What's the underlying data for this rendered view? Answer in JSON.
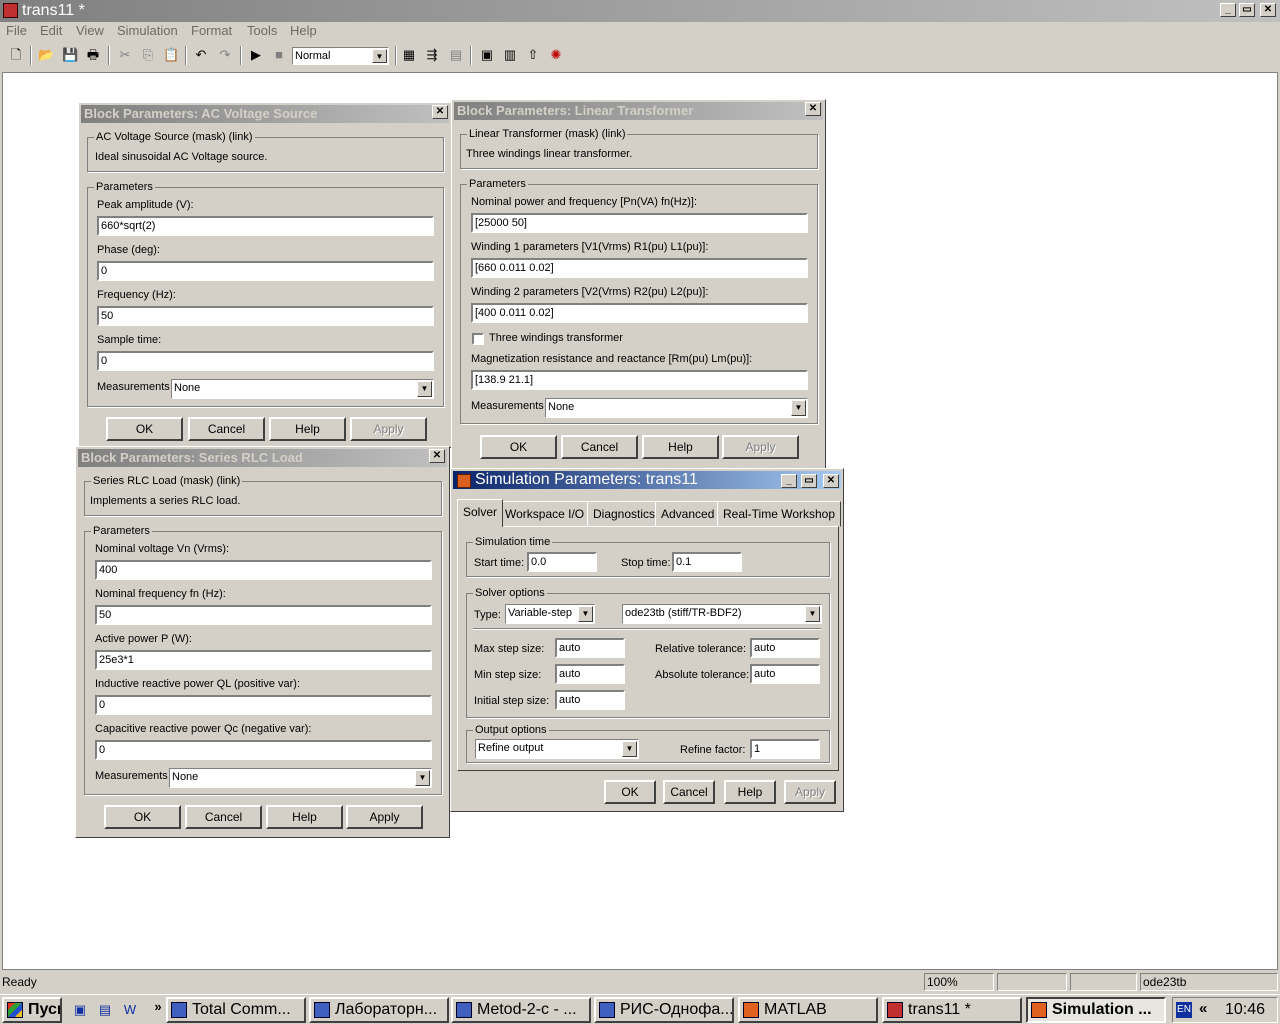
{
  "window": {
    "title": "trans11 *",
    "min": "_",
    "max": "▭",
    "close": "✕"
  },
  "menu": [
    "File",
    "Edit",
    "View",
    "Simulation",
    "Format",
    "Tools",
    "Help"
  ],
  "toolbar": {
    "mode": "Normal"
  },
  "ac": {
    "title": "Block Parameters: AC Voltage Source",
    "mask_label": "AC Voltage Source (mask) (link)",
    "description": "Ideal sinusoidal AC Voltage source.",
    "params_label": "Parameters",
    "peak_label": "Peak amplitude (V):",
    "peak": "660*sqrt(2)",
    "phase_label": "Phase (deg):",
    "phase": "0",
    "freq_label": "Frequency (Hz):",
    "freq": "50",
    "sample_label": "Sample time:",
    "sample": "0",
    "meas_label": "Measurements",
    "meas": "None",
    "ok": "OK",
    "cancel": "Cancel",
    "help": "Help",
    "apply": "Apply"
  },
  "lt": {
    "title": "Block Parameters: Linear Transformer",
    "mask_label": "Linear Transformer (mask) (link)",
    "description": "Three windings linear transformer.",
    "params_label": "Parameters",
    "nominal_label": "Nominal power and frequency [Pn(VA) fn(Hz)]:",
    "nominal": "[25000 50]",
    "w1_label": "Winding 1 parameters [V1(Vrms) R1(pu) L1(pu)]:",
    "w1": "[660 0.011 0.02]",
    "w2_label": "Winding 2 parameters [V2(Vrms) R2(pu) L2(pu)]:",
    "w2": "[400 0.011 0.02]",
    "three_label": "Three windings transformer",
    "mag_label": "Magnetization resistance and reactance [Rm(pu) Lm(pu)]:",
    "mag": "[138.9 21.1]",
    "meas_label": "Measurements",
    "meas": "None",
    "ok": "OK",
    "cancel": "Cancel",
    "help": "Help",
    "apply": "Apply"
  },
  "rlc": {
    "title": "Block Parameters: Series RLC Load",
    "mask_label": "Series RLC Load (mask) (link)",
    "description": "Implements a series RLC load.",
    "params_label": "Parameters",
    "vn_label": "Nominal voltage Vn (Vrms):",
    "vn": "400",
    "fn_label": "Nominal frequency fn (Hz):",
    "fn": "50",
    "p_label": "Active power P (W):",
    "p": "25e3*1",
    "ql_label": "Inductive reactive power QL (positive var):",
    "ql": "0",
    "qc_label": "Capacitive reactive power Qc (negative var):",
    "qc": "0",
    "meas_label": "Measurements",
    "meas": "None",
    "ok": "OK",
    "cancel": "Cancel",
    "help": "Help",
    "apply": "Apply"
  },
  "sim": {
    "title": "Simulation Parameters: trans11",
    "tabs": [
      "Solver",
      "Workspace I/O",
      "Diagnostics",
      "Advanced",
      "Real-Time Workshop"
    ],
    "time_label": "Simulation time",
    "start_label": "Start time:",
    "start": "0.0",
    "stop_label": "Stop time:",
    "stop": "0.1",
    "solver_label": "Solver options",
    "type_label": "Type:",
    "type": "Variable-step",
    "solver": "ode23tb (stiff/TR-BDF2)",
    "maxstep_label": "Max step size:",
    "maxstep": "auto",
    "minstep_label": "Min step size:",
    "minstep": "auto",
    "initstep_label": "Initial step size:",
    "initstep": "auto",
    "reltol_label": "Relative tolerance:",
    "reltol": "auto",
    "abstol_label": "Absolute tolerance:",
    "abstol": "auto",
    "output_label": "Output options",
    "output": "Refine output",
    "refine_label": "Refine factor:",
    "refine": "1",
    "ok": "OK",
    "cancel": "Cancel",
    "help": "Help",
    "apply": "Apply"
  },
  "status": {
    "text": "Ready",
    "zoom": "100%",
    "solver": "ode23tb"
  },
  "taskbar": {
    "start": "Пуск",
    "items": [
      "Total Comm...",
      "Лабораторн...",
      "Metod-2-с - ...",
      "РИС-Однофа...",
      "MATLAB",
      "trans11 *",
      "Simulation ..."
    ],
    "lang": "EN",
    "chevron": "«",
    "clock": "10:46"
  }
}
